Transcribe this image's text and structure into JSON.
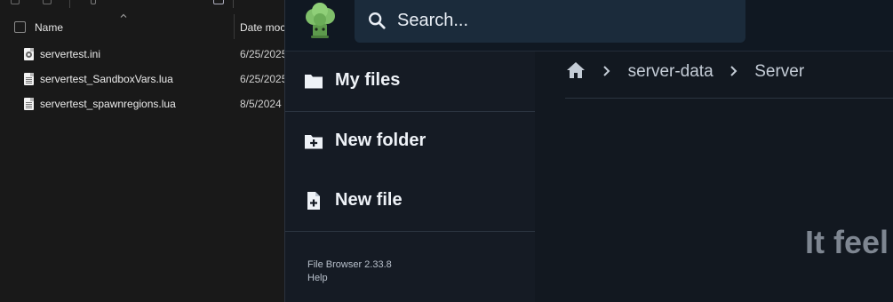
{
  "explorer": {
    "columns": {
      "name": "Name",
      "date": "Date moc"
    },
    "files": [
      {
        "name": "servertest.ini",
        "date": "6/25/2025",
        "icon": "settings-file-icon"
      },
      {
        "name": "servertest_SandboxVars.lua",
        "date": "6/25/2025",
        "icon": "text-file-icon"
      },
      {
        "name": "servertest_spawnregions.lua",
        "date": "8/5/2024",
        "icon": "text-file-icon"
      }
    ]
  },
  "filebrowser": {
    "search": {
      "placeholder": "Search..."
    },
    "sidebar": {
      "items": [
        {
          "label": "My files",
          "icon": "folder-icon"
        },
        {
          "label": "New folder",
          "icon": "new-folder-icon"
        },
        {
          "label": "New file",
          "icon": "new-file-icon"
        }
      ],
      "footer": {
        "version": "File Browser 2.33.8",
        "help": "Help"
      }
    },
    "breadcrumb": {
      "items": [
        "server-data",
        "Server"
      ]
    },
    "main": {
      "empty_message": "It feel"
    },
    "colors": {
      "topbar": "#101822",
      "search_bg": "#1b2b3b",
      "sidebar_bg": "#151b24",
      "logo_green": "#7fbf6a"
    }
  }
}
